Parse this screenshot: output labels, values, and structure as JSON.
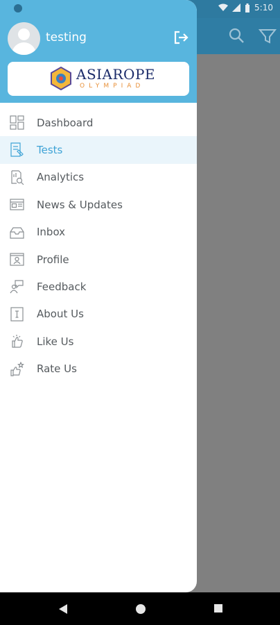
{
  "status": {
    "time": "5:10"
  },
  "user": {
    "name": "testing"
  },
  "logo": {
    "title": "ASIAROPE",
    "subtitle": "OLYMPIAD"
  },
  "menu": [
    {
      "label": "Dashboard",
      "icon": "dashboard-icon"
    },
    {
      "label": "Tests",
      "icon": "tests-icon",
      "active": true
    },
    {
      "label": "Analytics",
      "icon": "analytics-icon"
    },
    {
      "label": "News & Updates",
      "icon": "news-icon"
    },
    {
      "label": "Inbox",
      "icon": "inbox-icon"
    },
    {
      "label": "Profile",
      "icon": "profile-icon"
    },
    {
      "label": "Feedback",
      "icon": "feedback-icon"
    },
    {
      "label": "About Us",
      "icon": "about-icon"
    },
    {
      "label": "Like Us",
      "icon": "like-icon"
    },
    {
      "label": "Rate Us",
      "icon": "rate-icon"
    }
  ],
  "colors": {
    "header": "#58b5de",
    "active_text": "#3fa3d6",
    "active_bg": "#eaf5fb",
    "appbar": "#2f7da4"
  }
}
